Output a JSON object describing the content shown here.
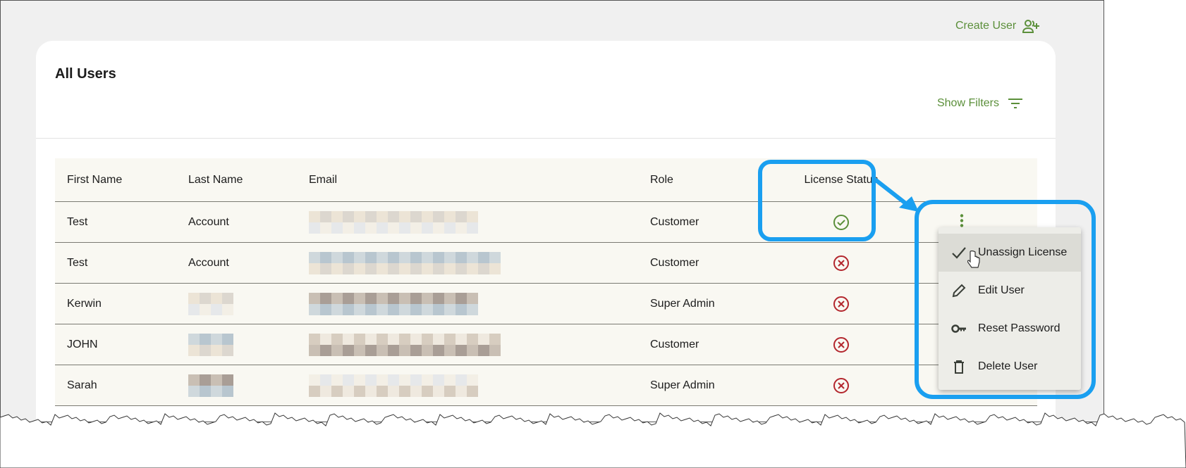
{
  "header": {
    "create_user": "Create User",
    "icon": "person-add-icon"
  },
  "card": {
    "title": "All Users",
    "show_filters": "Show Filters",
    "filter_icon": "filter-lines-icon"
  },
  "table": {
    "columns": [
      "First Name",
      "Last Name",
      "Email",
      "Role",
      "License Status"
    ],
    "rows": [
      {
        "first": "Test",
        "last": "Account",
        "role": "Customer",
        "license": "licensed"
      },
      {
        "first": "Test",
        "last": "Account",
        "role": "Customer",
        "license": "unlicensed"
      },
      {
        "first": "Kerwin",
        "last": "",
        "role": "Super Admin",
        "license": "unlicensed"
      },
      {
        "first": "JOHN",
        "last": "",
        "role": "Customer",
        "license": "unlicensed"
      },
      {
        "first": "Sarah",
        "last": "",
        "role": "Super Admin",
        "license": "unlicensed"
      }
    ]
  },
  "menu": {
    "items": [
      {
        "label": "Unassign License",
        "icon": "check-icon"
      },
      {
        "label": "Edit User",
        "icon": "pencil-icon"
      },
      {
        "label": "Reset Password",
        "icon": "key-icon"
      },
      {
        "label": "Delete User",
        "icon": "trash-icon"
      }
    ]
  },
  "colors": {
    "accent": "#5b8f3a",
    "error": "#b3262d",
    "highlight": "#1a9ff0"
  }
}
